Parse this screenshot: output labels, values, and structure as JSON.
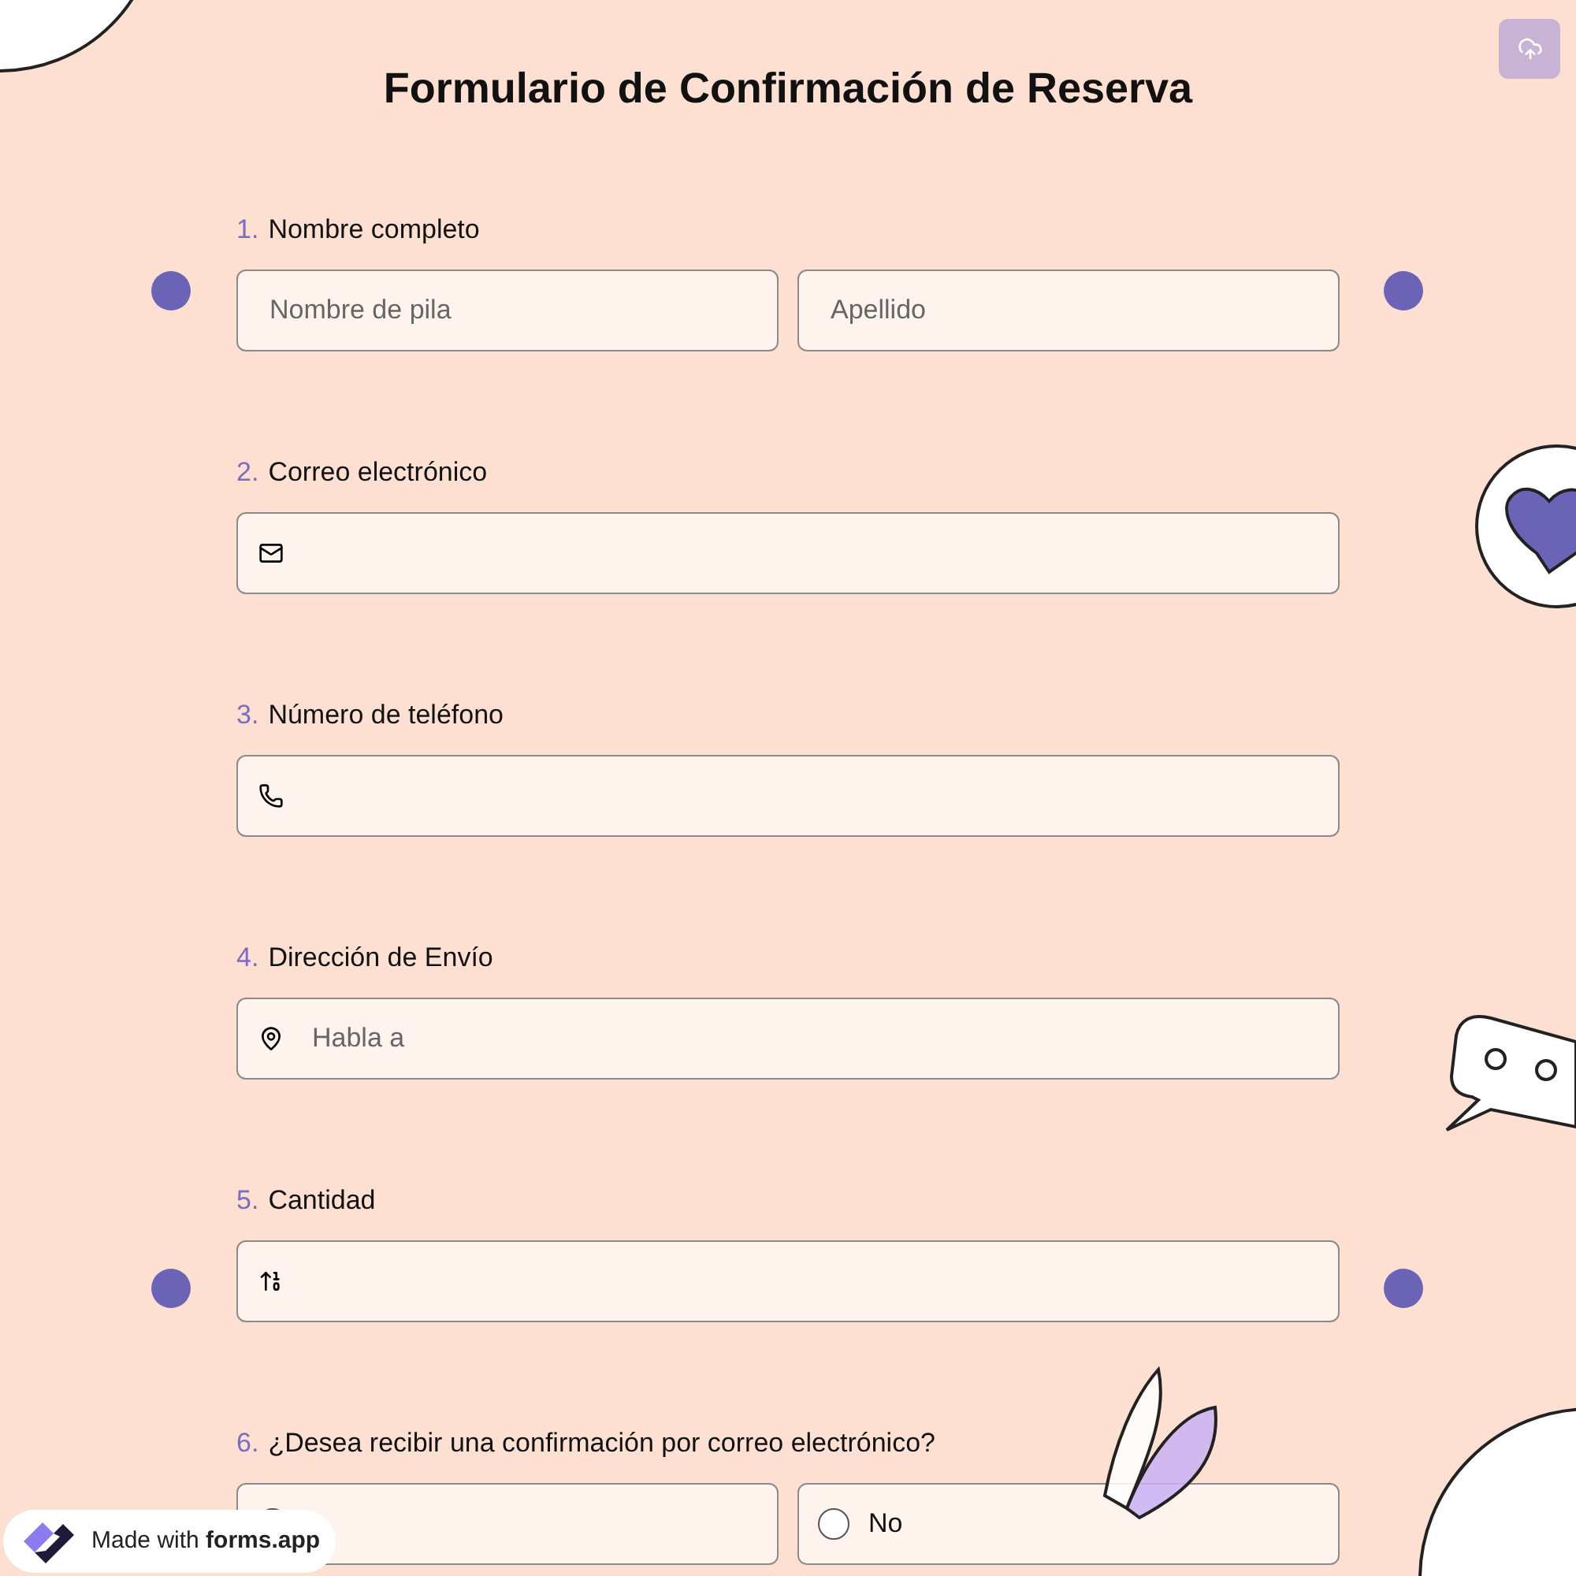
{
  "title": "Formulario de Confirmación de Reserva",
  "questions": [
    {
      "number": "1.",
      "label": "Nombre completo",
      "kind": "name",
      "placeholders": [
        "Nombre de pila",
        "Apellido"
      ]
    },
    {
      "number": "2.",
      "label": "Correo electrónico",
      "kind": "email"
    },
    {
      "number": "3.",
      "label": "Número de teléfono",
      "kind": "phone"
    },
    {
      "number": "4.",
      "label": "Dirección de Envío",
      "kind": "address",
      "placeholders": [
        "Habla a"
      ]
    },
    {
      "number": "5.",
      "label": "Cantidad",
      "kind": "number"
    },
    {
      "number": "6.",
      "label": "¿Desea recibir una confirmación por correo electrónico?",
      "kind": "choice",
      "options": [
        {
          "selected": false
        },
        {
          "label": "No",
          "selected": false
        }
      ]
    }
  ],
  "badge": {
    "prefix": "Made with",
    "brand": "forms.app"
  }
}
